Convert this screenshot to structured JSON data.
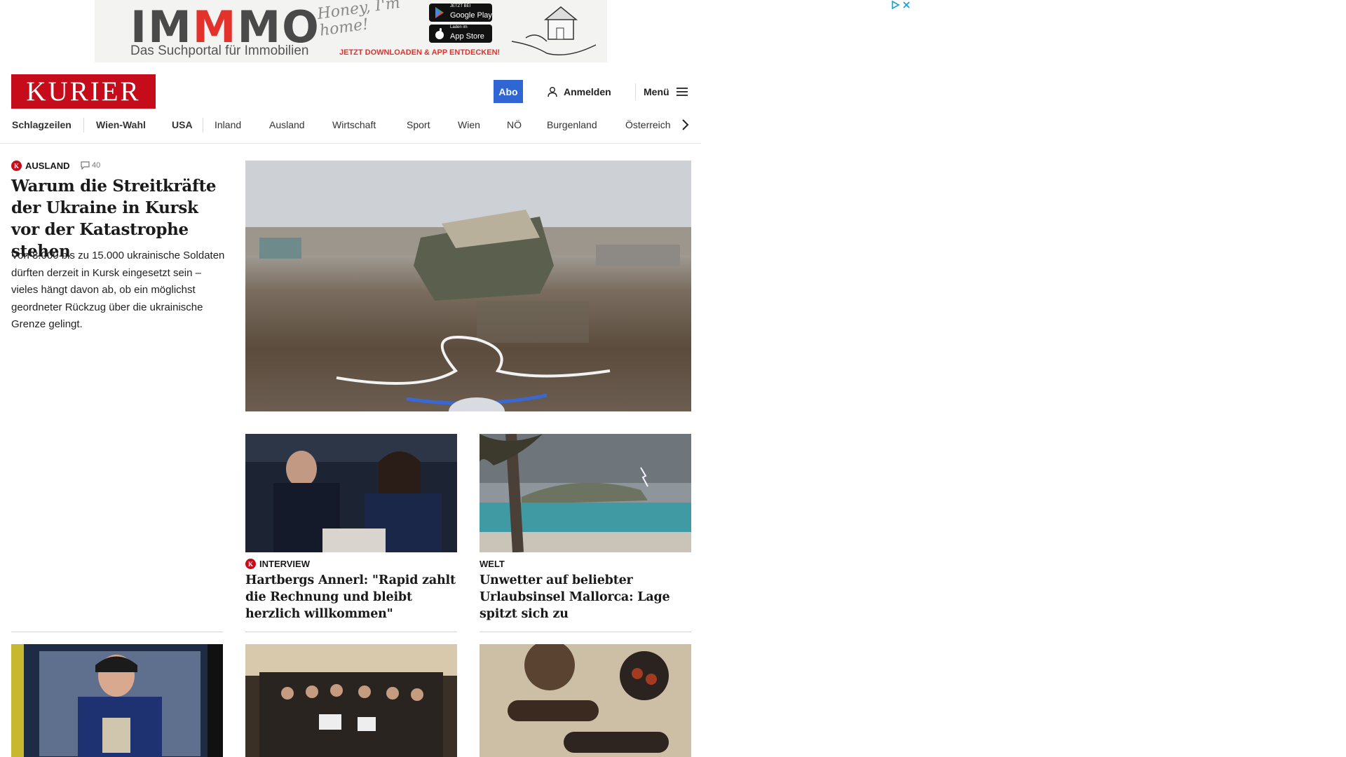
{
  "ad": {
    "brand_prefix": "IM",
    "brand_highlight": "M",
    "brand_suffix": "MO",
    "script_text": "Honey, I'm home!",
    "subtitle": "Das Suchportal für Immobilien",
    "cta": "JETZT DOWNLOADEN & APP ENTDECKEN!",
    "google_small": "JETZT BEI",
    "google_label": "Google Play",
    "apple_small": "Laden im",
    "apple_label": "App Store",
    "icons": [
      "adchoices-icon",
      "close-icon"
    ]
  },
  "header": {
    "logo": "KURIER",
    "abo": "Abo",
    "login": "Anmelden",
    "menu": "Menü",
    "brand_color": "#c60c1b",
    "accent_color": "#2f66d4"
  },
  "nav": {
    "items": [
      "Schlagzeilen",
      "Wien-Wahl",
      "USA",
      "Inland",
      "Ausland",
      "Wirtschaft",
      "Sport",
      "Wien",
      "NÖ",
      "Burgenland",
      "Österreich"
    ]
  },
  "main_article": {
    "badge": "K",
    "category": "AUSLAND",
    "comments": "40",
    "headline": "Warum die Streitkräfte der Ukraine in Kursk vor der Katastrophe stehen",
    "teaser": "Von 8.000 bis zu 15.000 ukrainische Soldaten dürften derzeit in Kursk eingesetzt sein – vieles hängt davon ab, ob ein möglichst geordneter Rückzug über die ukrainische Grenze gelingt."
  },
  "cards": [
    {
      "badge": "K",
      "category": "INTERVIEW",
      "headline": "Hartbergs Annerl: \"Rapid zahlt die Rechnung und bleibt herzlich willkommen\""
    },
    {
      "category": "WELT",
      "headline": "Unwetter auf beliebter Urlaubsinsel Mallorca: Lage spitzt sich zu"
    }
  ],
  "bottom_row_icons": [
    "shop-camera-image",
    "crowd-celebration-image",
    "food-plates-image"
  ]
}
